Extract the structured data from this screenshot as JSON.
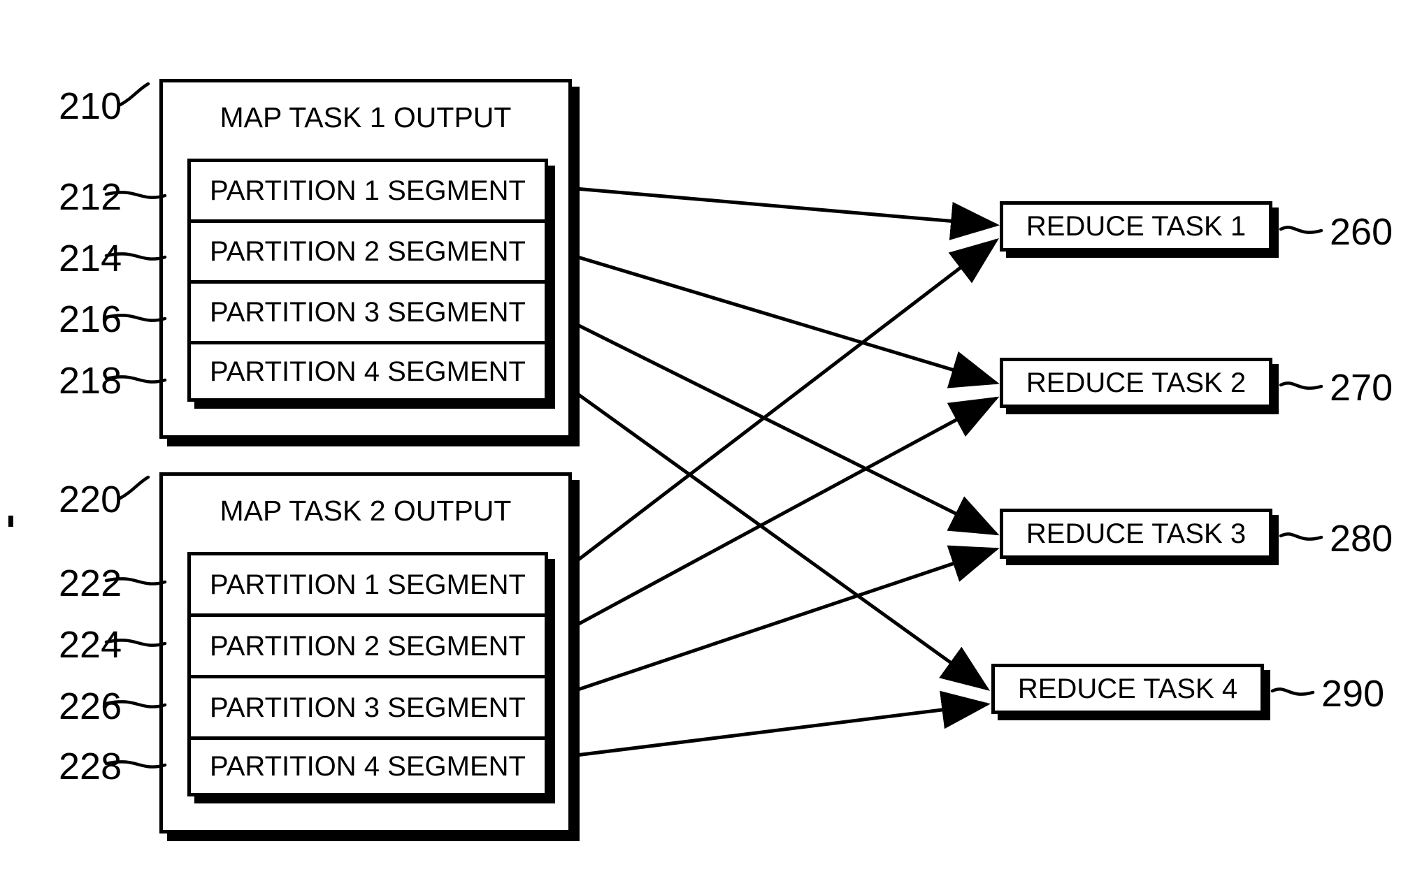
{
  "figure": {
    "type": "patent-diagram",
    "description": "MapReduce shuffle diagram: two map task outputs each with four partition segments feeding four reduce tasks"
  },
  "map_tasks": [
    {
      "ref": "210",
      "title": "MAP TASK 1 OUTPUT",
      "partitions": [
        {
          "ref": "212",
          "label": "PARTITION 1 SEGMENT"
        },
        {
          "ref": "214",
          "label": "PARTITION 2 SEGMENT"
        },
        {
          "ref": "216",
          "label": "PARTITION 3 SEGMENT"
        },
        {
          "ref": "218",
          "label": "PARTITION 4 SEGMENT"
        }
      ]
    },
    {
      "ref": "220",
      "title": "MAP TASK 2 OUTPUT",
      "partitions": [
        {
          "ref": "222",
          "label": "PARTITION 1 SEGMENT"
        },
        {
          "ref": "224",
          "label": "PARTITION 2 SEGMENT"
        },
        {
          "ref": "226",
          "label": "PARTITION 3 SEGMENT"
        },
        {
          "ref": "228",
          "label": "PARTITION 4 SEGMENT"
        }
      ]
    }
  ],
  "reduce_tasks": [
    {
      "ref": "260",
      "label": "REDUCE TASK 1"
    },
    {
      "ref": "270",
      "label": "REDUCE TASK 2"
    },
    {
      "ref": "280",
      "label": "REDUCE TASK 3"
    },
    {
      "ref": "290",
      "label": "REDUCE TASK 4"
    }
  ],
  "colors": {
    "stroke": "#000000",
    "background": "#ffffff"
  }
}
